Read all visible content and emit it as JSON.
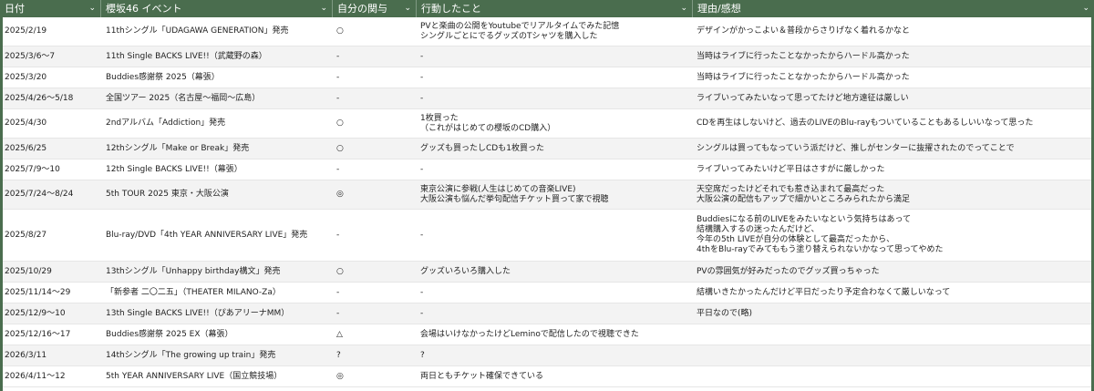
{
  "columns": [
    {
      "label": "日付"
    },
    {
      "label": "櫻坂46 イベント"
    },
    {
      "label": "自分の関与"
    },
    {
      "label": "行動したこと"
    },
    {
      "label": "理由/感想"
    }
  ],
  "rows": [
    {
      "date": "2025/2/19",
      "event": "11thシングル「UDAGAWA GENERATION」発売",
      "involvement": "○",
      "action": "PVと楽曲の公開をYoutubeでリアルタイムでみた記憶\nシングルごとにでるグッズのTシャツを購入した",
      "reason": "デザインがかっこよい＆普段からさりげなく着れるかなと"
    },
    {
      "date": "2025/3/6〜7",
      "event": "11th Single BACKS LIVE!!（武蔵野の森）",
      "involvement": "-",
      "action": "-",
      "reason": "当時はライブに行ったことなかったからハードル高かった"
    },
    {
      "date": "2025/3/20",
      "event": "Buddies感謝祭 2025（幕張）",
      "involvement": "-",
      "action": "-",
      "reason": "当時はライブに行ったことなかったからハードル高かった"
    },
    {
      "date": "2025/4/26〜5/18",
      "event": "全国ツアー 2025（名古屋〜福岡〜広島）",
      "involvement": "-",
      "action": "-",
      "reason": "ライブいってみたいなって思ってたけど地方遠征は厳しい"
    },
    {
      "date": "2025/4/30",
      "event": "2ndアルバム「Addiction」発売",
      "involvement": "○",
      "action": "1枚買った\n（これがはじめての櫻坂のCD購入）",
      "reason": "CDを再生はしないけど、過去のLIVEのBlu-rayもついていることもあるしいいなって思った"
    },
    {
      "date": "2025/6/25",
      "event": "12thシングル「Make or Break」発売",
      "involvement": "○",
      "action": "グッズも買ったしCDも1枚買った",
      "reason": "シングルは買ってもなっていう派だけど、推しがセンターに抜擢されたのでってことで"
    },
    {
      "date": "2025/7/9〜10",
      "event": "12th Single BACKS LIVE!!（幕張）",
      "involvement": "-",
      "action": "-",
      "reason": "ライブいってみたいけど平日はさすがに厳しかった"
    },
    {
      "date": "2025/7/24〜8/24",
      "event": "5th TOUR 2025 東京・大阪公演",
      "involvement": "◎",
      "action": "東京公演に参戦(人生はじめての音楽LIVE)\n大阪公演も悩んだ挙句配信チケット買って家で視聴",
      "reason": "天空席だったけどそれでも惹き込まれて最高だった\n大阪公演の配信もアップで細かいところみられたから満足"
    },
    {
      "date": "2025/8/27",
      "event": "Blu-ray/DVD「4th YEAR ANNIVERSARY LIVE」発売",
      "involvement": "-",
      "action": "-",
      "reason": "Buddiesになる前のLIVEをみたいなという気持ちはあって\n結構購入するの迷ったんだけど、\n今年の5th LIVEが自分の体験として最高だったから、\n4thをBlu-rayでみてももう塗り替えられないかなって思ってやめた"
    },
    {
      "date": "2025/10/29",
      "event": "13thシングル「Unhappy birthday構文」発売",
      "involvement": "○",
      "action": "グッズいろいろ購入した",
      "reason": "PVの雰囲気が好みだったのでグッズ買っちゃった"
    },
    {
      "date": "2025/11/14〜29",
      "event": "「新参者 二〇二五」（THEATER MILANO-Za）",
      "involvement": "-",
      "action": "-",
      "reason": "結構いきたかったんだけど平日だったり予定合わなくて厳しいなって"
    },
    {
      "date": "2025/12/9〜10",
      "event": "13th Single BACKS LIVE!!（ぴあアリーナMM）",
      "involvement": "-",
      "action": "-",
      "reason": "平日なので(略)"
    },
    {
      "date": "2025/12/16〜17",
      "event": "Buddies感謝祭 2025 EX（幕張）",
      "involvement": "△",
      "action": "会場はいけなかったけどLeminoで配信したので視聴できた",
      "reason": ""
    },
    {
      "date": "2026/3/11",
      "event": "14thシングル「The growing up train」発売",
      "involvement": "?",
      "action": "?",
      "reason": ""
    },
    {
      "date": "2026/4/11〜12",
      "event": "5th YEAR ANNIVERSARY LIVE（国立競技場）",
      "involvement": "◎",
      "action": "両日ともチケット確保できている",
      "reason": ""
    }
  ]
}
